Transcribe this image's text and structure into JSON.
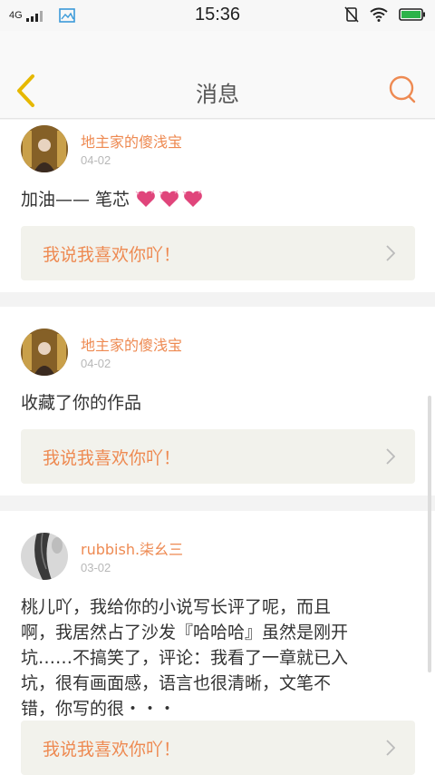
{
  "status_bar": {
    "network": "4G",
    "time": "15:36"
  },
  "header": {
    "title": "消息"
  },
  "messages": [
    {
      "username": "地主家的傻浅宝",
      "date": "04-02",
      "content": "加油—— 笔芯",
      "reply_label": "我说我喜欢你吖！"
    },
    {
      "username": "地主家的傻浅宝",
      "date": "04-02",
      "content": "收藏了你的作品",
      "reply_label": "我说我喜欢你吖！"
    },
    {
      "username": "rubbish.柒幺三",
      "date": "03-02",
      "content_lines": [
        "桃儿吖，我给你的小说写长评了呢，而且",
        "啊，我居然占了沙发『哈哈哈』虽然是刚开",
        "坑……不搞笑了，评论：我看了一章就已入",
        "坑，很有画面感，语言也很清晰，文笔不",
        "错，你写的很・・・"
      ],
      "reply_label": "我说我喜欢你吖！"
    }
  ],
  "colors": {
    "accent": "#ee8a52",
    "heart": "#e0457b",
    "back_icon": "#e6b800",
    "reply_bg": "#f2f2ec"
  }
}
